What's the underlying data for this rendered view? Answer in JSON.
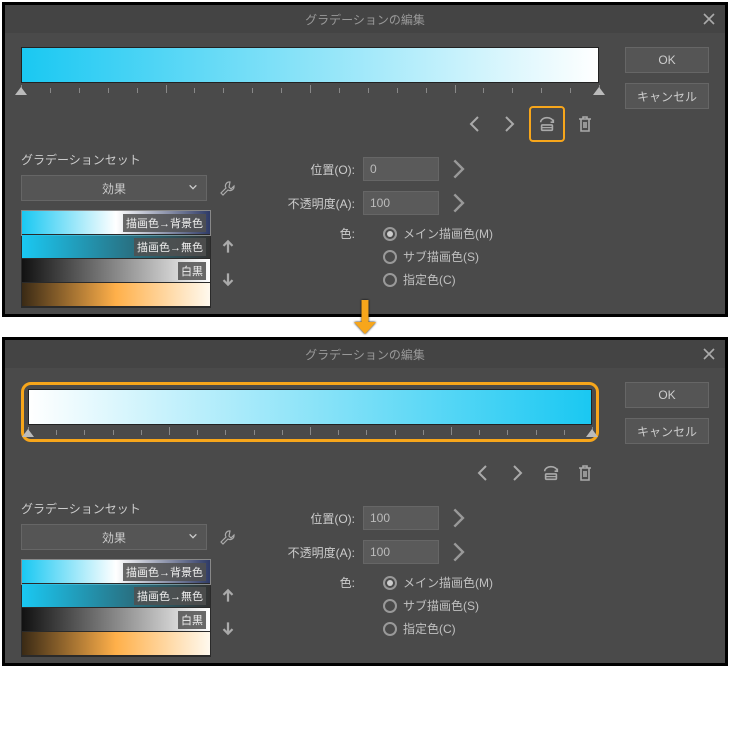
{
  "panels": [
    {
      "title": "グラデーションの編集",
      "ok": "OK",
      "cancel": "キャンセル",
      "position_label": "位置(O):",
      "position_value": "0",
      "opacity_label": "不透明度(A):",
      "opacity_value": "100",
      "color_label": "色:",
      "flip_highlighted": true,
      "gradbar_highlighted": false,
      "gradient_reversed": false,
      "radios": [
        {
          "label": "メイン描画色(M)",
          "checked": true
        },
        {
          "label": "サブ描画色(S)",
          "checked": false
        },
        {
          "label": "指定色(C)",
          "checked": false
        }
      ],
      "set_title": "グラデーションセット",
      "set_select": "効果",
      "presets": [
        {
          "label": "描画色→背景色",
          "selected": true
        },
        {
          "label": "描画色→無色",
          "selected": false
        },
        {
          "label": "白黒",
          "selected": false
        },
        {
          "label": "",
          "selected": false
        }
      ]
    },
    {
      "title": "グラデーションの編集",
      "ok": "OK",
      "cancel": "キャンセル",
      "position_label": "位置(O):",
      "position_value": "100",
      "opacity_label": "不透明度(A):",
      "opacity_value": "100",
      "color_label": "色:",
      "flip_highlighted": false,
      "gradbar_highlighted": true,
      "gradient_reversed": true,
      "radios": [
        {
          "label": "メイン描画色(M)",
          "checked": true
        },
        {
          "label": "サブ描画色(S)",
          "checked": false
        },
        {
          "label": "指定色(C)",
          "checked": false
        }
      ],
      "set_title": "グラデーションセット",
      "set_select": "効果",
      "presets": [
        {
          "label": "描画色→背景色",
          "selected": true
        },
        {
          "label": "描画色→無色",
          "selected": false
        },
        {
          "label": "白黒",
          "selected": false
        },
        {
          "label": "",
          "selected": false
        }
      ]
    }
  ]
}
